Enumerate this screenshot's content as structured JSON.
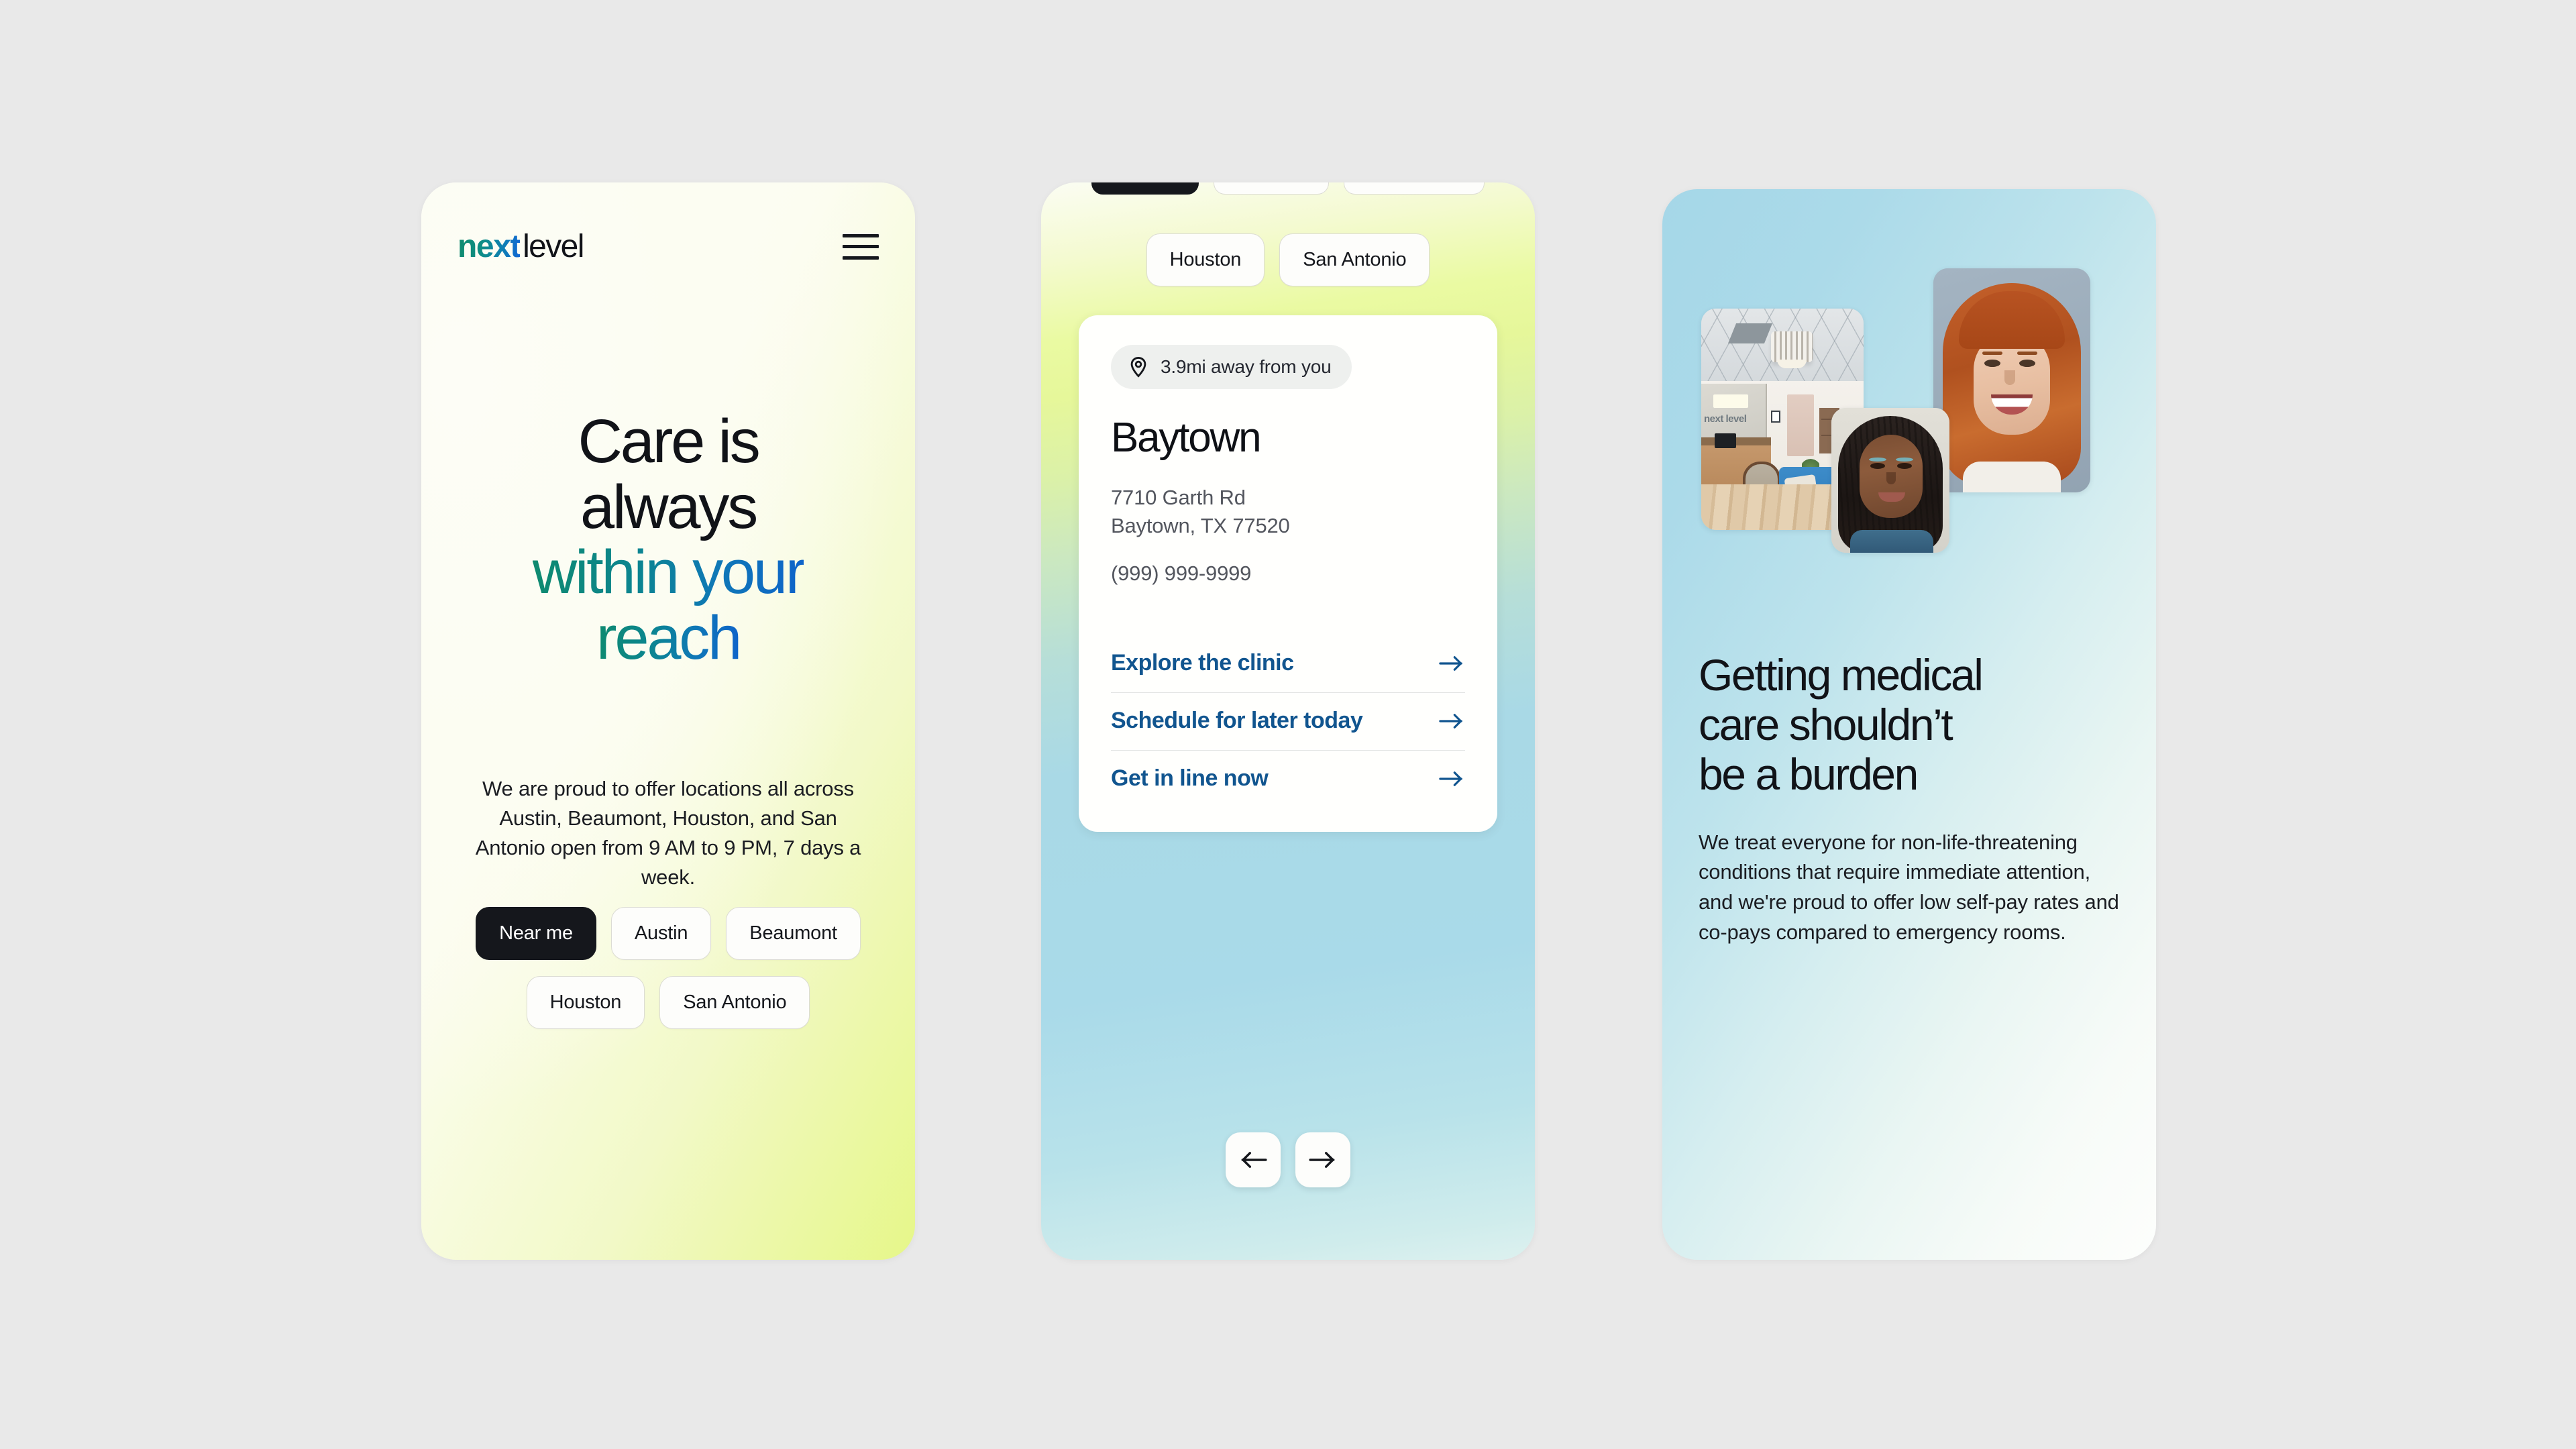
{
  "page": {
    "background_color": "#e9e9e9",
    "brand_gradient_from": "#118b6d",
    "brand_gradient_to": "#1065d6",
    "link_color": "#11558f"
  },
  "phone1": {
    "logo": {
      "part1": "next",
      "part2": "level"
    },
    "menu_icon": "hamburger-menu-icon",
    "headline": {
      "line1": "Care is",
      "line2": "always",
      "line3": "within your",
      "line4": "reach"
    },
    "subtext": "We are proud to offer locations all across Austin, Beaumont, Houston, and San Antonio open from 9 AM to 9 PM, 7 days a week.",
    "chips_row1": [
      {
        "label": "Near me",
        "active": true
      },
      {
        "label": "Austin",
        "active": false
      },
      {
        "label": "Beaumont",
        "active": false
      }
    ],
    "chips_row2": [
      {
        "label": "Houston",
        "active": false
      },
      {
        "label": "San Antonio",
        "active": false
      }
    ]
  },
  "phone2": {
    "tabs": [
      {
        "label": "Houston"
      },
      {
        "label": "San Antonio"
      }
    ],
    "card": {
      "distance_badge": "3.9mi away from you",
      "pin_icon": "location-pin-icon",
      "clinic_name": "Baytown",
      "address_line1": "7710 Garth Rd",
      "address_line2": "Baytown, TX 77520",
      "phone": "(999) 999-9999",
      "links": [
        {
          "label": "Explore the clinic",
          "icon": "arrow-right-icon"
        },
        {
          "label": "Schedule for later today",
          "icon": "arrow-right-icon"
        },
        {
          "label": "Get in line now",
          "icon": "arrow-right-icon"
        }
      ]
    },
    "carousel": {
      "prev_icon": "arrow-left-icon",
      "next_icon": "arrow-right-icon"
    }
  },
  "phone3": {
    "photos": [
      {
        "name": "clinic-lobby-photo"
      },
      {
        "name": "patient-portrait-photo-1"
      },
      {
        "name": "patient-portrait-photo-2"
      }
    ],
    "heading": {
      "line1": "Getting medical",
      "line2": "care shouldn’t",
      "line3": "be a burden"
    },
    "body": "We treat everyone for non-life-threatening conditions that require immediate attention, and we're proud to offer low self-pay rates and co-pays compared to emergency rooms."
  }
}
